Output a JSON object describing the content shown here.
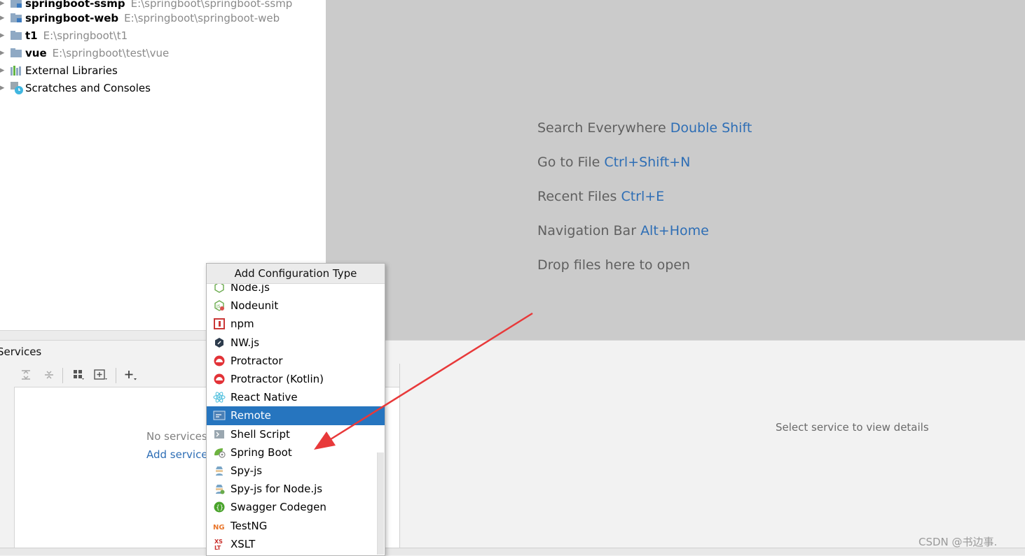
{
  "project_tree": {
    "rows": [
      {
        "name": "springboot-ssmp",
        "path": "E:\\springboot\\springboot-ssmp"
      },
      {
        "name": "springboot-web",
        "path": "E:\\springboot\\springboot-web"
      },
      {
        "name": "t1",
        "path": "E:\\springboot\\t1"
      },
      {
        "name": "vue",
        "path": "E:\\springboot\\test\\vue"
      }
    ],
    "external_libraries": "External Libraries",
    "scratches": "Scratches and Consoles"
  },
  "editor_hints": {
    "search_text": "Search Everywhere",
    "search_shortcut": "Double Shift",
    "goto_text": "Go to File",
    "goto_shortcut": "Ctrl+Shift+N",
    "recent_text": "Recent Files",
    "recent_shortcut": "Ctrl+E",
    "nav_text": "Navigation Bar",
    "nav_shortcut": "Alt+Home",
    "drop_text": "Drop files here to open"
  },
  "services": {
    "title": "Services",
    "empty_text": "No services",
    "add_link": "Add service",
    "detail_placeholder": "Select service to view details"
  },
  "popup": {
    "title": "Add Configuration Type",
    "items": [
      {
        "label": "Node.js",
        "icon": "nodejs-icon"
      },
      {
        "label": "Nodeunit",
        "icon": "nodeunit-icon"
      },
      {
        "label": "npm",
        "icon": "npm-icon"
      },
      {
        "label": "NW.js",
        "icon": "nwjs-icon"
      },
      {
        "label": "Protractor",
        "icon": "protractor-icon"
      },
      {
        "label": "Protractor (Kotlin)",
        "icon": "protractor-icon"
      },
      {
        "label": "React Native",
        "icon": "react-icon"
      },
      {
        "label": "Remote",
        "icon": "remote-icon"
      },
      {
        "label": "Shell Script",
        "icon": "shell-script-icon"
      },
      {
        "label": "Spring Boot",
        "icon": "spring-boot-icon"
      },
      {
        "label": "Spy-js",
        "icon": "spy-js-icon"
      },
      {
        "label": "Spy-js for Node.js",
        "icon": "spy-js-node-icon"
      },
      {
        "label": "Swagger Codegen",
        "icon": "swagger-icon"
      },
      {
        "label": "TestNG",
        "icon": "testng-icon"
      },
      {
        "label": "XSLT",
        "icon": "xslt-icon"
      }
    ],
    "selected_index": 7
  },
  "watermark": "CSDN @书边事.",
  "colors": {
    "accent_link": "#2e6eb5",
    "selection": "#2675bf",
    "annotation_arrow": "#e8393a"
  }
}
